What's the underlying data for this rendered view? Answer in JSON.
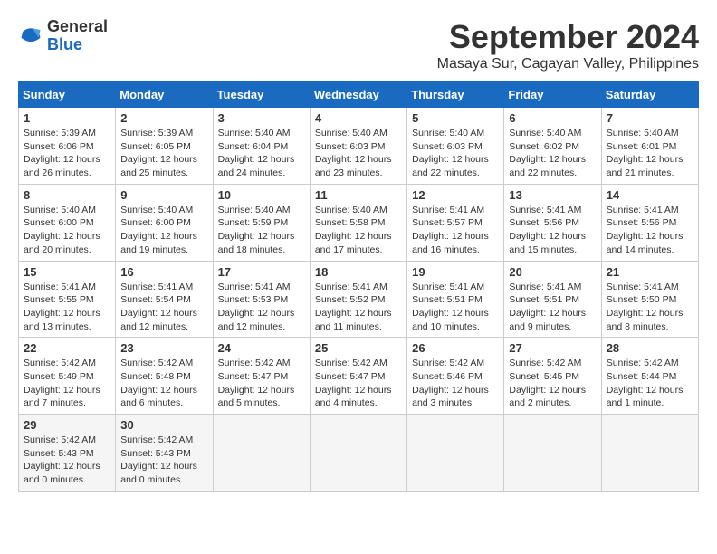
{
  "logo": {
    "general": "General",
    "blue": "Blue"
  },
  "header": {
    "month": "September 2024",
    "location": "Masaya Sur, Cagayan Valley, Philippines"
  },
  "weekdays": [
    "Sunday",
    "Monday",
    "Tuesday",
    "Wednesday",
    "Thursday",
    "Friday",
    "Saturday"
  ],
  "weeks": [
    [
      {
        "day": "1",
        "sunrise": "5:39 AM",
        "sunset": "6:06 PM",
        "daylight": "12 hours and 26 minutes."
      },
      {
        "day": "2",
        "sunrise": "5:39 AM",
        "sunset": "6:05 PM",
        "daylight": "12 hours and 25 minutes."
      },
      {
        "day": "3",
        "sunrise": "5:40 AM",
        "sunset": "6:04 PM",
        "daylight": "12 hours and 24 minutes."
      },
      {
        "day": "4",
        "sunrise": "5:40 AM",
        "sunset": "6:03 PM",
        "daylight": "12 hours and 23 minutes."
      },
      {
        "day": "5",
        "sunrise": "5:40 AM",
        "sunset": "6:03 PM",
        "daylight": "12 hours and 22 minutes."
      },
      {
        "day": "6",
        "sunrise": "5:40 AM",
        "sunset": "6:02 PM",
        "daylight": "12 hours and 22 minutes."
      },
      {
        "day": "7",
        "sunrise": "5:40 AM",
        "sunset": "6:01 PM",
        "daylight": "12 hours and 21 minutes."
      }
    ],
    [
      {
        "day": "8",
        "sunrise": "5:40 AM",
        "sunset": "6:00 PM",
        "daylight": "12 hours and 20 minutes."
      },
      {
        "day": "9",
        "sunrise": "5:40 AM",
        "sunset": "6:00 PM",
        "daylight": "12 hours and 19 minutes."
      },
      {
        "day": "10",
        "sunrise": "5:40 AM",
        "sunset": "5:59 PM",
        "daylight": "12 hours and 18 minutes."
      },
      {
        "day": "11",
        "sunrise": "5:40 AM",
        "sunset": "5:58 PM",
        "daylight": "12 hours and 17 minutes."
      },
      {
        "day": "12",
        "sunrise": "5:41 AM",
        "sunset": "5:57 PM",
        "daylight": "12 hours and 16 minutes."
      },
      {
        "day": "13",
        "sunrise": "5:41 AM",
        "sunset": "5:56 PM",
        "daylight": "12 hours and 15 minutes."
      },
      {
        "day": "14",
        "sunrise": "5:41 AM",
        "sunset": "5:56 PM",
        "daylight": "12 hours and 14 minutes."
      }
    ],
    [
      {
        "day": "15",
        "sunrise": "5:41 AM",
        "sunset": "5:55 PM",
        "daylight": "12 hours and 13 minutes."
      },
      {
        "day": "16",
        "sunrise": "5:41 AM",
        "sunset": "5:54 PM",
        "daylight": "12 hours and 12 minutes."
      },
      {
        "day": "17",
        "sunrise": "5:41 AM",
        "sunset": "5:53 PM",
        "daylight": "12 hours and 12 minutes."
      },
      {
        "day": "18",
        "sunrise": "5:41 AM",
        "sunset": "5:52 PM",
        "daylight": "12 hours and 11 minutes."
      },
      {
        "day": "19",
        "sunrise": "5:41 AM",
        "sunset": "5:51 PM",
        "daylight": "12 hours and 10 minutes."
      },
      {
        "day": "20",
        "sunrise": "5:41 AM",
        "sunset": "5:51 PM",
        "daylight": "12 hours and 9 minutes."
      },
      {
        "day": "21",
        "sunrise": "5:41 AM",
        "sunset": "5:50 PM",
        "daylight": "12 hours and 8 minutes."
      }
    ],
    [
      {
        "day": "22",
        "sunrise": "5:42 AM",
        "sunset": "5:49 PM",
        "daylight": "12 hours and 7 minutes."
      },
      {
        "day": "23",
        "sunrise": "5:42 AM",
        "sunset": "5:48 PM",
        "daylight": "12 hours and 6 minutes."
      },
      {
        "day": "24",
        "sunrise": "5:42 AM",
        "sunset": "5:47 PM",
        "daylight": "12 hours and 5 minutes."
      },
      {
        "day": "25",
        "sunrise": "5:42 AM",
        "sunset": "5:47 PM",
        "daylight": "12 hours and 4 minutes."
      },
      {
        "day": "26",
        "sunrise": "5:42 AM",
        "sunset": "5:46 PM",
        "daylight": "12 hours and 3 minutes."
      },
      {
        "day": "27",
        "sunrise": "5:42 AM",
        "sunset": "5:45 PM",
        "daylight": "12 hours and 2 minutes."
      },
      {
        "day": "28",
        "sunrise": "5:42 AM",
        "sunset": "5:44 PM",
        "daylight": "12 hours and 1 minute."
      }
    ],
    [
      {
        "day": "29",
        "sunrise": "5:42 AM",
        "sunset": "5:43 PM",
        "daylight": "12 hours and 0 minutes."
      },
      {
        "day": "30",
        "sunrise": "5:42 AM",
        "sunset": "5:43 PM",
        "daylight": "12 hours and 0 minutes."
      },
      null,
      null,
      null,
      null,
      null
    ]
  ],
  "labels": {
    "sunrise": "Sunrise:",
    "sunset": "Sunset:",
    "daylight": "Daylight:"
  }
}
